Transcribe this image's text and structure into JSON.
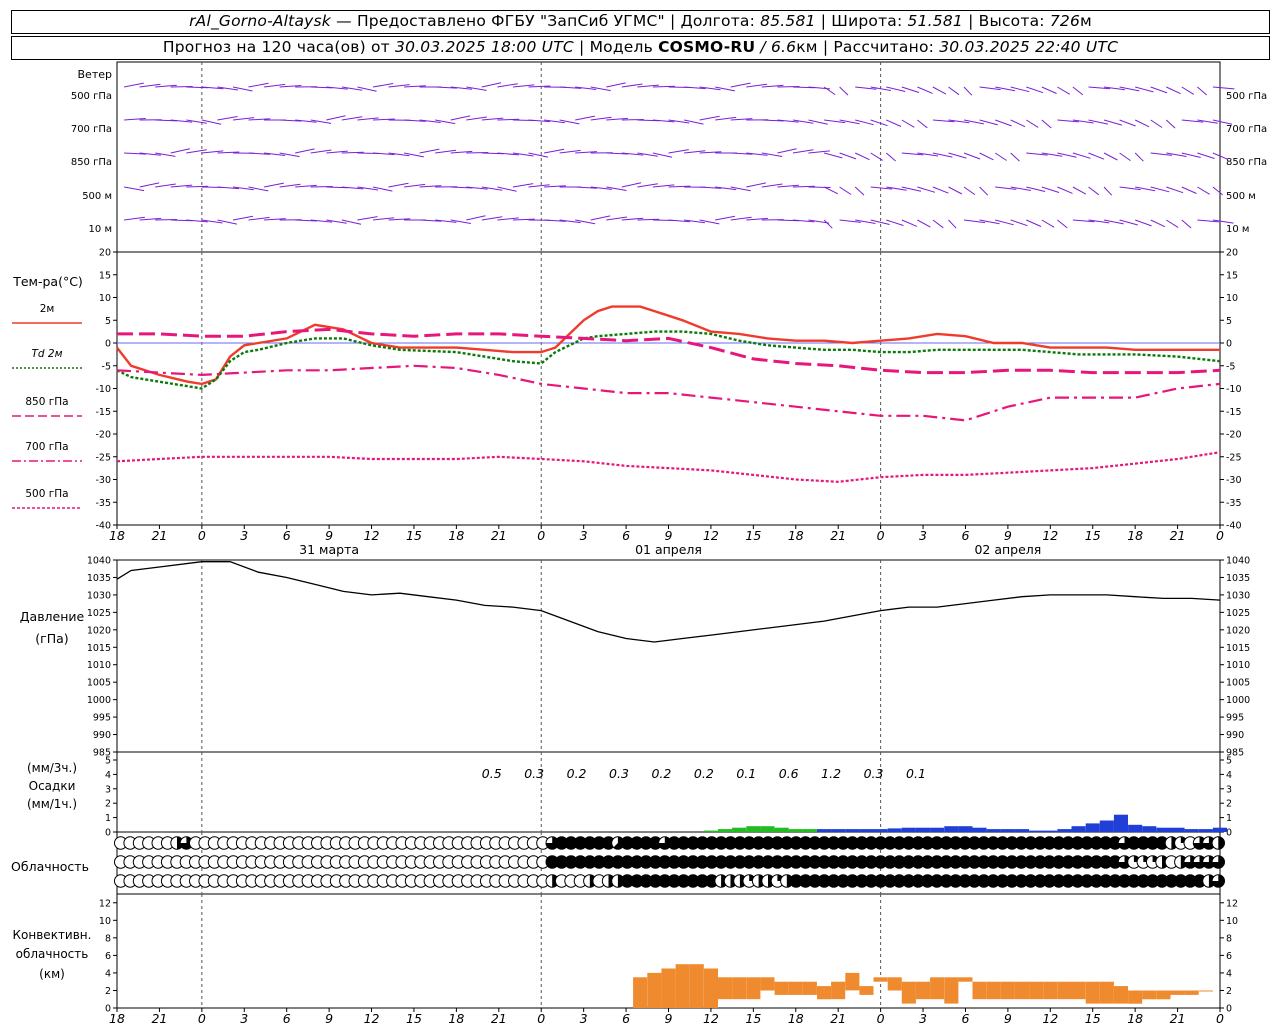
{
  "header": {
    "station": "rAl_Gorno-Altaysk",
    "dash": " — ",
    "provider": "Предоставлено ФГБУ \"ЗапСиб УГМС\"",
    "sep": " | ",
    "lon_label": "Долгота: ",
    "lon_value": "85.581",
    "lat_label": "Широта: ",
    "lat_value": "51.581",
    "alt_label": "Высота: ",
    "alt_value": "726",
    "alt_unit": "м",
    "fc_label": "Прогноз на 120 часа(ов) от ",
    "fc_start": "30.03.2025 18:00 UTC",
    "model_label": "Модель ",
    "model_name": "COSMO-RU",
    "model_res_sep": " / ",
    "model_res": "6.6",
    "model_res_unit": "км",
    "calc_label": "Рассчитано: ",
    "calc_time": "30.03.2025 22:40 UTC"
  },
  "time_axis": {
    "hour_labels": [
      "18",
      "21",
      "0",
      "3",
      "6",
      "9",
      "12",
      "15",
      "18",
      "21",
      "0",
      "3",
      "6",
      "9",
      "12",
      "15",
      "18",
      "21",
      "0",
      "3",
      "6",
      "9",
      "12",
      "15",
      "18",
      "21",
      "0"
    ],
    "dates": [
      {
        "label": "31 марта",
        "at_hour": 15
      },
      {
        "label": "01 апреля",
        "at_hour": 39
      },
      {
        "label": "02 апреля",
        "at_hour": 63
      }
    ],
    "midnights_hours": [
      6,
      30,
      54,
      78
    ]
  },
  "wind": {
    "title": "Ветер",
    "levels": [
      "500 гПа",
      "700 гПа",
      "850 гПа",
      "500 м",
      "10  м"
    ]
  },
  "temperature": {
    "title": "Тем-ра(°C)",
    "ylim": [
      -40,
      20
    ],
    "ticks": [
      20,
      15,
      10,
      5,
      0,
      -5,
      -10,
      -15,
      -20,
      -25,
      -30,
      -35,
      -40
    ],
    "legend": [
      {
        "label": "2м",
        "color": "#ef3b2c",
        "style": "solid"
      },
      {
        "label": "Td  2м",
        "color": "#0a7a0a",
        "style": "dotted"
      },
      {
        "label": "850 гПа",
        "color": "#e8167a",
        "style": "dashed"
      },
      {
        "label": "700 гПа",
        "color": "#e8167a",
        "style": "dashdot"
      },
      {
        "label": "500 гПа",
        "color": "#e8167a",
        "style": "dot"
      }
    ]
  },
  "pressure": {
    "title": "Давление",
    "unit": "(гПа)",
    "ylim": [
      985,
      1040
    ],
    "ticks": [
      1040,
      1035,
      1030,
      1025,
      1020,
      1015,
      1010,
      1005,
      1000,
      995,
      990,
      985
    ]
  },
  "precip": {
    "unit3": "(мм/3ч.)",
    "title": "Осадки",
    "unit1": "(мм/1ч.)",
    "ylim": [
      0,
      5
    ],
    "ticks": [
      5,
      4,
      3,
      2,
      1,
      0
    ],
    "labels": [
      {
        "h": 27,
        "text": "0.5"
      },
      {
        "h": 30,
        "text": "0.3"
      },
      {
        "h": 33,
        "text": "0.2"
      },
      {
        "h": 36,
        "text": "0.3"
      },
      {
        "h": 39,
        "text": "0.2"
      },
      {
        "h": 42,
        "text": "0.2"
      },
      {
        "h": 45,
        "text": "0.1"
      },
      {
        "h": 48,
        "text": "0.6"
      },
      {
        "h": 51,
        "text": "1.2"
      },
      {
        "h": 54,
        "text": "0.3"
      },
      {
        "h": 57,
        "text": "0.1"
      }
    ],
    "colors": {
      "rain": "#22bb22",
      "snow": "#1f3fd6"
    }
  },
  "cloud": {
    "title": "Облачность"
  },
  "convective": {
    "title1": "Конвективн.",
    "title2": "облачность",
    "unit": "(км)",
    "ylim": [
      0,
      13
    ],
    "ticks": [
      12,
      10,
      8,
      6,
      4,
      2,
      0
    ],
    "color": "#ef8a2e"
  },
  "chart_data": {
    "type": "line",
    "title": "rAl_Gorno-Altaysk",
    "x_unit": "hours from 30.03.2025 18:00 UTC",
    "series": [
      {
        "name": "2м",
        "x": [
          0,
          1,
          3,
          5,
          6,
          7,
          8,
          9,
          10,
          12,
          14,
          16,
          18,
          20,
          24,
          26,
          28,
          30,
          31,
          32,
          33,
          34,
          35,
          36,
          37,
          38,
          39,
          40,
          42,
          44,
          46,
          48,
          50,
          52,
          54,
          56,
          58,
          60,
          62,
          64,
          66,
          68,
          70,
          72,
          75,
          78
        ],
        "values": [
          -1,
          -5,
          -7,
          -8.5,
          -9,
          -8,
          -3,
          -0.5,
          0,
          1,
          4,
          3,
          0,
          -1,
          -1,
          -1.5,
          -2,
          -2,
          -1,
          2,
          5,
          7,
          8,
          8,
          8,
          7,
          6,
          5,
          2.5,
          2,
          1,
          0.5,
          0.5,
          0,
          0.5,
          1,
          2,
          1.5,
          0,
          0,
          -1,
          -1,
          -1,
          -1.5,
          -1.5,
          -1.5
        ]
      },
      {
        "name": "Td  2м",
        "x": [
          0,
          1,
          3,
          5,
          6,
          7,
          8,
          9,
          10,
          12,
          14,
          16,
          18,
          20,
          24,
          26,
          28,
          30,
          31,
          32,
          33,
          34,
          36,
          38,
          40,
          42,
          44,
          46,
          48,
          50,
          52,
          54,
          56,
          58,
          60,
          62,
          64,
          66,
          68,
          70,
          72,
          75,
          78
        ],
        "values": [
          -6,
          -7.5,
          -8.5,
          -9.5,
          -10,
          -8,
          -4,
          -2,
          -1.5,
          0,
          1,
          1,
          -0.5,
          -1.5,
          -2,
          -3,
          -4,
          -4.5,
          -2,
          -0.5,
          1,
          1.5,
          2,
          2.5,
          2.5,
          2,
          0.5,
          -0.5,
          -1,
          -1.5,
          -1.5,
          -2,
          -2,
          -1.5,
          -1.5,
          -1.5,
          -1.5,
          -2,
          -2.5,
          -2.5,
          -2.5,
          -3,
          -4
        ]
      },
      {
        "name": "850 гПа",
        "x": [
          0,
          3,
          6,
          9,
          12,
          15,
          18,
          21,
          24,
          27,
          30,
          33,
          36,
          39,
          42,
          45,
          48,
          51,
          54,
          57,
          60,
          63,
          66,
          69,
          72,
          75,
          78
        ],
        "values": [
          2,
          2,
          1.5,
          1.5,
          2.5,
          3,
          2,
          1.5,
          2,
          2,
          1.5,
          1,
          0.5,
          1,
          -1,
          -3.5,
          -4.5,
          -5,
          -6,
          -6.5,
          -6.5,
          -6,
          -6,
          -6.5,
          -6.5,
          -6.5,
          -6
        ]
      },
      {
        "name": "700 гПа",
        "x": [
          0,
          3,
          6,
          9,
          12,
          15,
          18,
          21,
          24,
          27,
          30,
          33,
          36,
          39,
          42,
          45,
          48,
          51,
          54,
          57,
          60,
          63,
          66,
          69,
          72,
          75,
          78
        ],
        "values": [
          -6,
          -6.5,
          -7,
          -6.5,
          -6,
          -6,
          -5.5,
          -5,
          -5.5,
          -7,
          -9,
          -10,
          -11,
          -11,
          -12,
          -13,
          -14,
          -15,
          -16,
          -16,
          -17,
          -14,
          -12,
          -12,
          -12,
          -10,
          -9
        ]
      },
      {
        "name": "500 гПа",
        "x": [
          0,
          3,
          6,
          9,
          12,
          15,
          18,
          21,
          24,
          27,
          30,
          33,
          36,
          39,
          42,
          45,
          48,
          51,
          54,
          57,
          60,
          63,
          66,
          69,
          72,
          75,
          78
        ],
        "values": [
          -26,
          -25.5,
          -25,
          -25,
          -25,
          -25,
          -25.5,
          -25.5,
          -25.5,
          -25,
          -25.5,
          -26,
          -27,
          -27.5,
          -28,
          -29,
          -30,
          -30.5,
          -29.5,
          -29,
          -29,
          -28.5,
          -28,
          -27.5,
          -26.5,
          -25.5,
          -24
        ]
      },
      {
        "name": "Давление",
        "x": [
          0,
          1,
          3,
          6,
          8,
          10,
          12,
          14,
          16,
          18,
          20,
          22,
          24,
          26,
          28,
          30,
          32,
          34,
          36,
          38,
          40,
          42,
          44,
          46,
          48,
          50,
          52,
          54,
          56,
          58,
          60,
          62,
          64,
          66,
          68,
          70,
          72,
          74,
          76,
          78
        ],
        "values": [
          1034.5,
          1037,
          1038,
          1039.5,
          1039.5,
          1036.5,
          1035,
          1033,
          1031,
          1030,
          1030.5,
          1029.5,
          1028.5,
          1027,
          1026.5,
          1025.5,
          1022.5,
          1019.5,
          1017.5,
          1016.5,
          1017.5,
          1018.5,
          1019.5,
          1020.5,
          1021.5,
          1022.5,
          1024,
          1025.5,
          1026.5,
          1026.5,
          1027.5,
          1028.5,
          1029.5,
          1030,
          1030,
          1030,
          1029.5,
          1029,
          1029,
          1028.5
        ]
      }
    ],
    "precip_1h": {
      "x": [
        42,
        43,
        44,
        45,
        46,
        47,
        48,
        49,
        50,
        51,
        52,
        53,
        54,
        55,
        56,
        57,
        58,
        59,
        60,
        61,
        62,
        63,
        64,
        65,
        66,
        67,
        68,
        69,
        70,
        71,
        72,
        73,
        74,
        75,
        76,
        77,
        78
      ],
      "values": [
        0.1,
        0.2,
        0.3,
        0.4,
        0.4,
        0.3,
        0.2,
        0.2,
        0.2,
        0.2,
        0.2,
        0.2,
        0.2,
        0.25,
        0.3,
        0.3,
        0.3,
        0.4,
        0.4,
        0.3,
        0.2,
        0.2,
        0.2,
        0.1,
        0.1,
        0.2,
        0.4,
        0.6,
        0.8,
        1.2,
        0.5,
        0.4,
        0.3,
        0.3,
        0.2,
        0.2,
        0.3
      ],
      "type": [
        "rain",
        "rain",
        "rain",
        "rain",
        "rain",
        "rain",
        "rain",
        "rain",
        "snow",
        "snow",
        "snow",
        "snow",
        "snow",
        "snow",
        "snow",
        "snow",
        "snow",
        "snow",
        "snow",
        "snow",
        "snow",
        "snow",
        "snow",
        "snow",
        "snow",
        "snow",
        "snow",
        "snow",
        "snow",
        "snow",
        "snow",
        "snow",
        "snow",
        "snow",
        "snow",
        "snow",
        "snow"
      ]
    },
    "convective_km": {
      "x": [
        37,
        38,
        39,
        40,
        41,
        42,
        43,
        44,
        45,
        46,
        47,
        48,
        49,
        50,
        51,
        52,
        53,
        54,
        55,
        56,
        57,
        58,
        59,
        60,
        61,
        62,
        63,
        64,
        65,
        66,
        67,
        68,
        69,
        70,
        71,
        72,
        73,
        74,
        75,
        76,
        77
      ],
      "bottom": [
        0,
        0,
        0,
        0,
        0,
        0,
        1,
        1,
        1,
        2,
        1.5,
        1.5,
        1.5,
        1,
        1,
        2,
        1.5,
        3,
        2,
        0.5,
        1,
        1,
        0.5,
        3,
        1,
        1,
        1,
        1,
        1,
        1,
        1,
        1,
        0.5,
        0.5,
        0.5,
        0.5,
        1,
        1,
        1.5,
        1.5,
        2
      ],
      "top": [
        3.5,
        4,
        4.5,
        5,
        5,
        4.5,
        3.5,
        3.5,
        3.5,
        3.5,
        3,
        3,
        3,
        2.5,
        3,
        4,
        2.5,
        3.5,
        3.5,
        3,
        3,
        3.5,
        3.5,
        3.5,
        3,
        3,
        3,
        3,
        3,
        3,
        3,
        3,
        3,
        3,
        2.5,
        2,
        2,
        2,
        2,
        2,
        2
      ]
    },
    "cloud_cover_octas": {
      "upper": [
        0,
        0,
        0,
        0,
        0,
        0,
        4,
        6,
        0,
        0,
        0,
        0,
        0,
        0,
        0,
        0,
        0,
        0,
        0,
        0,
        0,
        0,
        0,
        0,
        0,
        0,
        0,
        0,
        0,
        0,
        0,
        0,
        0,
        0,
        0,
        0,
        0,
        0,
        0,
        0,
        0,
        0,
        0,
        0,
        0,
        0,
        6,
        8,
        8,
        8,
        8,
        8,
        8,
        5,
        8,
        8,
        8,
        8,
        6,
        8,
        8,
        8,
        8,
        8,
        8,
        8,
        8,
        8,
        8,
        8,
        8,
        8,
        8,
        8,
        8,
        8,
        8,
        8,
        8,
        8,
        8,
        8,
        8,
        8,
        8,
        8,
        8,
        8,
        8,
        8,
        8,
        8,
        8,
        8,
        8,
        8,
        8,
        8,
        8,
        8,
        8,
        8,
        8,
        8,
        8,
        8,
        8,
        6,
        8,
        8,
        8,
        8,
        4,
        2,
        0,
        6,
        6,
        4
      ],
      "middle": [
        0,
        0,
        0,
        0,
        0,
        0,
        0,
        0,
        0,
        0,
        0,
        0,
        0,
        0,
        0,
        0,
        0,
        0,
        0,
        0,
        0,
        0,
        0,
        0,
        0,
        0,
        0,
        0,
        0,
        0,
        0,
        0,
        0,
        0,
        0,
        0,
        0,
        0,
        0,
        0,
        0,
        0,
        0,
        0,
        0,
        0,
        8,
        8,
        8,
        8,
        8,
        8,
        8,
        8,
        8,
        8,
        8,
        8,
        8,
        8,
        8,
        8,
        8,
        8,
        8,
        8,
        8,
        8,
        8,
        8,
        8,
        8,
        8,
        8,
        8,
        8,
        8,
        8,
        8,
        8,
        8,
        8,
        8,
        8,
        8,
        8,
        8,
        8,
        8,
        8,
        8,
        8,
        8,
        8,
        8,
        8,
        8,
        8,
        8,
        8,
        8,
        8,
        8,
        8,
        8,
        8,
        8,
        6,
        2,
        2,
        2,
        4,
        0,
        4,
        6,
        6,
        6,
        6
      ],
      "lower": [
        0,
        0,
        0,
        0,
        0,
        0,
        0,
        0,
        0,
        0,
        0,
        0,
        0,
        0,
        0,
        0,
        0,
        0,
        0,
        0,
        0,
        0,
        0,
        0,
        0,
        0,
        0,
        0,
        0,
        0,
        0,
        0,
        0,
        0,
        0,
        0,
        0,
        0,
        0,
        0,
        0,
        0,
        0,
        0,
        0,
        0,
        4,
        0,
        0,
        0,
        4,
        0,
        4,
        4,
        8,
        8,
        8,
        8,
        8,
        8,
        8,
        8,
        8,
        8,
        4,
        4,
        4,
        2,
        4,
        4,
        2,
        4,
        8,
        8,
        8,
        8,
        8,
        8,
        8,
        8,
        8,
        8,
        8,
        8,
        8,
        8,
        8,
        8,
        8,
        8,
        8,
        8,
        8,
        8,
        8,
        8,
        8,
        8,
        8,
        8,
        8,
        8,
        8,
        8,
        8,
        8,
        8,
        8,
        8,
        8,
        8,
        8,
        8,
        8,
        8,
        8,
        4,
        6
      ]
    }
  }
}
